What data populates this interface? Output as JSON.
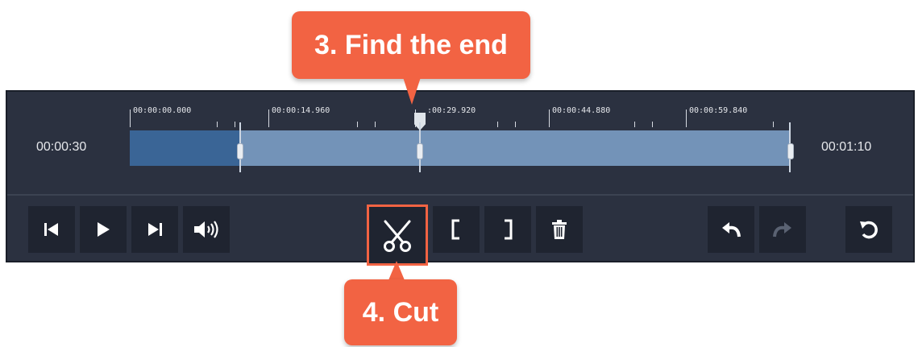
{
  "callouts": {
    "step3": "3. Find the end",
    "step4": "4. Cut"
  },
  "timeline": {
    "start_time": "00:00:30",
    "end_time": "00:01:10",
    "ruler_labels": [
      "00:00:00.000",
      "00:00:14.960",
      "00:00:29.920",
      "00:00:44.880",
      "00:00:59.840"
    ],
    "ruler_labels_visible": [
      "00:00:00.000",
      "00:00:14.960",
      ":00:29.920",
      "00:00:44.880",
      "00:00:59.840"
    ],
    "selected_fraction": 0.167
  },
  "toolbar": {
    "buttons": [
      {
        "name": "skip-to-start",
        "icon": "skip-start-icon",
        "enabled": true
      },
      {
        "name": "play",
        "icon": "play-icon",
        "enabled": true
      },
      {
        "name": "skip-to-end",
        "icon": "skip-end-icon",
        "enabled": true
      },
      {
        "name": "volume",
        "icon": "volume-icon",
        "enabled": true
      },
      {
        "name": "split",
        "icon": "scissors-icon",
        "enabled": true,
        "highlighted": true
      },
      {
        "name": "set-in-point",
        "icon": "bracket-left-icon",
        "enabled": true
      },
      {
        "name": "set-out-point",
        "icon": "bracket-right-icon",
        "enabled": true
      },
      {
        "name": "delete",
        "icon": "trash-icon",
        "enabled": true
      },
      {
        "name": "undo",
        "icon": "undo-icon",
        "enabled": true
      },
      {
        "name": "redo",
        "icon": "redo-icon",
        "enabled": false
      },
      {
        "name": "reset",
        "icon": "reset-icon",
        "enabled": true
      }
    ]
  },
  "colors": {
    "accent": "#f26343",
    "panel_bg": "#2b3140",
    "button_bg": "#1f2430",
    "track": "#7393b8",
    "track_selected": "#3a6596"
  }
}
